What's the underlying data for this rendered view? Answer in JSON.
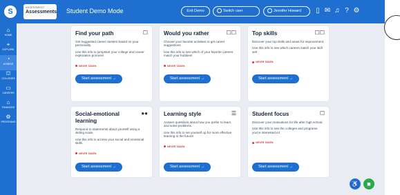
{
  "app": {
    "logo_icon": "S",
    "breadcrumb_small": "ASSESSMENT",
    "breadcrumb_title": "Assessments",
    "mode_label": "Student Demo Mode"
  },
  "topbar": {
    "exit_demo": "Exit Demo",
    "switch_user": "Switch user",
    "user_name": "Jennifer Howard",
    "icons": [
      "document-icon",
      "mail-icon",
      "bell-icon",
      "help-icon",
      "gear-icon"
    ]
  },
  "sidenav": {
    "items": [
      {
        "label": "HOME",
        "icon": "⌂"
      },
      {
        "label": "EXPLORE",
        "icon": "⌖"
      },
      {
        "label": "ASSESS",
        "icon": "◔"
      },
      {
        "label": "COLLEGES",
        "icon": "⛫"
      },
      {
        "label": "CAREERS",
        "icon": "▭"
      },
      {
        "label": "FINANCES",
        "icon": "⌂"
      },
      {
        "label": "PROGRAMS",
        "icon": "⚙"
      }
    ]
  },
  "cards": [
    {
      "title": "Find your path",
      "desc": "Get suggested career clusters based on your personality.",
      "info": "Use this info to jumpstart your college and career exploration process!",
      "status": "NEVER TAKEN",
      "button": "Start assessment →"
    },
    {
      "title": "Would you rather",
      "desc": "Choose your favorite activities to get career suggestions.",
      "info": "Use this info to see which of your favorite careers match your hobbies!",
      "status": "NEVER TAKEN",
      "button": "Start assessment →"
    },
    {
      "title": "Top skills",
      "desc": "Discover your top skills and areas for improvement.",
      "info": "Use this info to see which careers match your skill set!",
      "status": "NEVER TAKEN",
      "button": "Start assessment →"
    },
    {
      "title": "Social-emotional learning",
      "desc": "Respond to statements about yourself using a sliding scale.",
      "info": "Use this info to access your social and emotional skills.",
      "status": "NEVER TAKEN",
      "button": "Start assessment →"
    },
    {
      "title": "Learning style",
      "desc": "Answer questions about how you prefer to learn and solve problems.",
      "info": "Use this info to set yourself up for more effective learning in the future!",
      "status": "NEVER TAKEN",
      "button": "Start assessment →"
    },
    {
      "title": "Student focus",
      "desc": "Discover your motivations for life after high school.",
      "info": "Use this info to see the colleges and programs you're interested in!",
      "status": "NEVER TAKEN",
      "button": "Start assessment →"
    }
  ],
  "colors": {
    "brand": "#1f6fd1",
    "status": "#d23b3b",
    "chat": "#2aa84a"
  }
}
